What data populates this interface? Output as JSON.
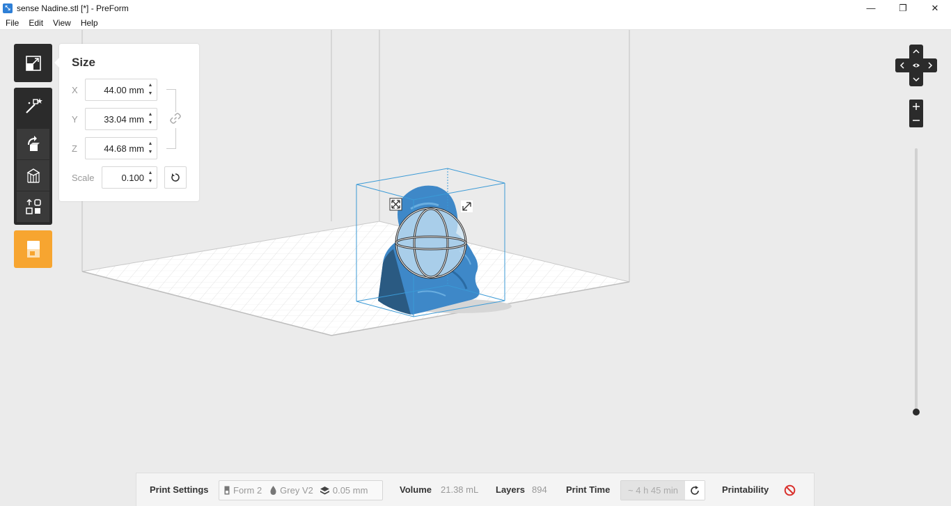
{
  "window": {
    "title": "sense Nadine.stl [*] - PreForm",
    "minimize": "—",
    "maximize": "❐",
    "close": "✕"
  },
  "menu": [
    "File",
    "Edit",
    "View",
    "Help"
  ],
  "toolbar": {
    "tools": [
      "size-icon",
      "magic-wand-icon",
      "rotate-icon",
      "supports-icon",
      "layout-icon",
      "printer-icon"
    ],
    "active_tool": "size-icon",
    "accent_color": "#f7a530"
  },
  "size_panel": {
    "title": "Size",
    "x_label": "X",
    "x_value": "44.00 mm",
    "y_label": "Y",
    "y_value": "33.04 mm",
    "z_label": "Z",
    "z_value": "44.68 mm",
    "scale_label": "Scale",
    "scale_value": "0.100",
    "proportional_link": true
  },
  "bottom_bar": {
    "print_settings_label": "Print Settings",
    "printer": "Form 2",
    "material": "Grey V2",
    "layer_height": "0.05 mm",
    "volume_label": "Volume",
    "volume_value": "21.38 mL",
    "layers_label": "Layers",
    "layers_value": "894",
    "print_time_label": "Print Time",
    "print_time_value": "~ 4 h 45 min",
    "printability_label": "Printability",
    "printability_status_color": "#d9302c"
  },
  "model": {
    "color": "#3e88c8"
  }
}
